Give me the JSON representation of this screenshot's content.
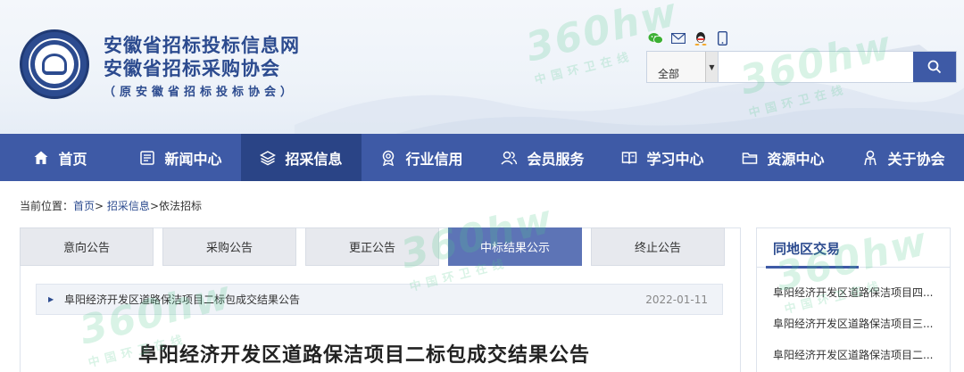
{
  "header": {
    "logo_icon": "association-seal",
    "title_line1": "安徽省招标投标信息网",
    "title_line2": "安徽省招标采购协会",
    "subtitle": "（原安徽省招标投标协会）",
    "social_icons": [
      "wechat-icon",
      "mail-icon",
      "qq-icon",
      "mobile-icon"
    ]
  },
  "search": {
    "scope_value": "全部",
    "placeholder": "",
    "button_icon": "search-icon"
  },
  "nav": {
    "items": [
      {
        "label": "首页",
        "icon": "home-icon"
      },
      {
        "label": "新闻中心",
        "icon": "news-icon"
      },
      {
        "label": "招采信息",
        "icon": "layers-icon"
      },
      {
        "label": "行业信用",
        "icon": "badge-icon"
      },
      {
        "label": "会员服务",
        "icon": "members-icon"
      },
      {
        "label": "学习中心",
        "icon": "book-icon"
      },
      {
        "label": "资源中心",
        "icon": "folder-icon"
      },
      {
        "label": "关于协会",
        "icon": "person-icon"
      }
    ],
    "active_index": 2
  },
  "breadcrumb": {
    "prefix": "当前位置：",
    "home": "首页",
    "level1": "招采信息",
    "level2": "依法招标",
    "sep": ">"
  },
  "tabs": [
    {
      "label": "意向公告"
    },
    {
      "label": "采购公告"
    },
    {
      "label": "更正公告"
    },
    {
      "label": "中标结果公示"
    },
    {
      "label": "终止公告"
    }
  ],
  "active_tab_index": 3,
  "article": {
    "list_title": "阜阳经济开发区道路保洁项目二标包成交结果公告",
    "list_date": "2022-01-11",
    "heading": "阜阳经济开发区道路保洁项目二标包成交结果公告"
  },
  "side": {
    "title": "同地区交易",
    "items": [
      "阜阳经济开发区道路保洁项目四...",
      "阜阳经济开发区道路保洁项目三...",
      "阜阳经济开发区道路保洁项目二..."
    ]
  },
  "watermark": {
    "brand": "360hw",
    "tagline": "中国环卫在线"
  },
  "colors": {
    "brand_blue": "#3e5aa6",
    "nav_active": "#2a4486",
    "tab_active": "#5d74b6",
    "title_blue": "#2c4b8f"
  }
}
